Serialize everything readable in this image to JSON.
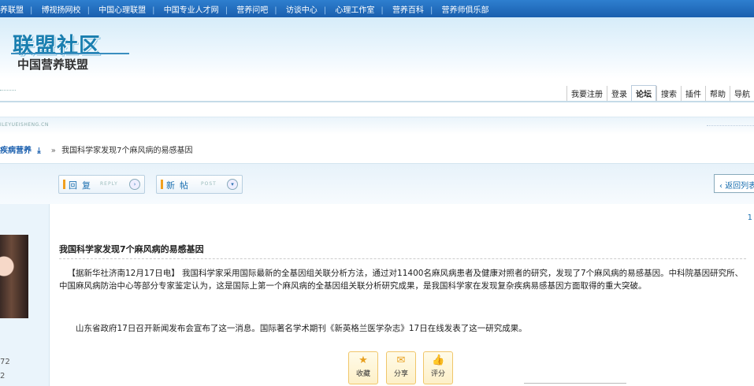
{
  "top_links": [
    "养联盟",
    "博视扬网校",
    "中国心理联盟",
    "中国专业人才网",
    "营养问吧",
    "访谈中心",
    "心理工作室",
    "营养百科",
    "营养师俱乐部"
  ],
  "logo": {
    "main": "联盟社区",
    "sub": "中国营养联盟"
  },
  "user_nav": [
    "我要注册",
    "登录",
    "论坛",
    "搜索",
    "插件",
    "帮助",
    "导航"
  ],
  "url_text": "ILEYUEISHENG.CN",
  "breadcrumb": {
    "forum": "疾病营养",
    "arrow": "»",
    "current": "我国科学家发现7个麻风病的易感基因"
  },
  "actions": {
    "reply": {
      "label": "回复",
      "en": "REPLY"
    },
    "new_post": {
      "label": "新帖",
      "en": "POST"
    },
    "back": "返回列表"
  },
  "page_number": "1",
  "left_numbers": [
    "72",
    "2"
  ],
  "post": {
    "title": "我国科学家发现7个麻风病的易感基因",
    "paragraph1": "【据新华社济南12月17日电】 我国科学家采用国际最新的全基因组关联分析方法，通过对11400名麻风病患者及健康对照者的研究，发现了7个麻风病的易感基因。中科院基因研究所、中国麻风病防治中心等部分专家鉴定认为，这是国际上第一个麻风病的全基因组关联分析研究成果，是我国科学家在发现复杂疾病易感基因方面取得的重大突破。",
    "paragraph2": "山东省政府17日召开新闻发布会宣布了这一消息。国际著名学术期刊《新英格兰医学杂志》17日在线发表了这一研究成果。"
  },
  "post_actions": [
    {
      "label": "收藏",
      "icon": "star-icon"
    },
    {
      "label": "分享",
      "icon": "share-icon"
    },
    {
      "label": "评分",
      "icon": "thumb-up-icon"
    }
  ],
  "colors": {
    "topbar": "#1a5fae",
    "accent_link": "#1a6fb0",
    "logo": "#1a7fb0"
  }
}
